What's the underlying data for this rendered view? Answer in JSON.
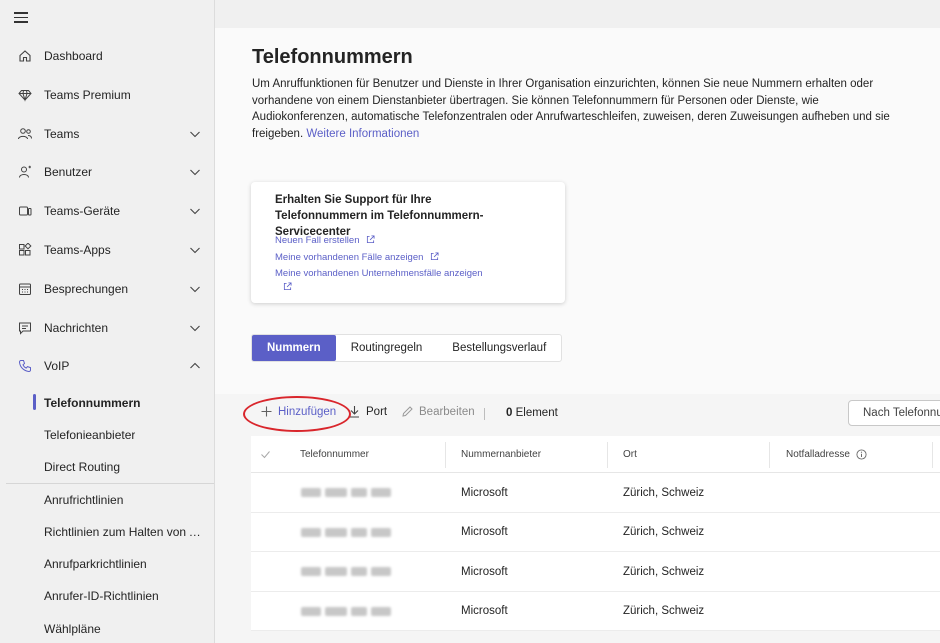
{
  "sidebar": {
    "items": [
      {
        "label": "Dashboard",
        "icon": "home-icon",
        "expandable": false
      },
      {
        "label": "Teams Premium",
        "icon": "diamond-icon",
        "expandable": false
      },
      {
        "label": "Teams",
        "icon": "people-icon",
        "expandable": true
      },
      {
        "label": "Benutzer",
        "icon": "person-icon",
        "expandable": true
      },
      {
        "label": "Teams-Geräte",
        "icon": "devices-icon",
        "expandable": true
      },
      {
        "label": "Teams-Apps",
        "icon": "apps-icon",
        "expandable": true
      },
      {
        "label": "Besprechungen",
        "icon": "calendar-icon",
        "expandable": true
      },
      {
        "label": "Nachrichten",
        "icon": "chat-icon",
        "expandable": true
      },
      {
        "label": "VoIP",
        "icon": "phone-icon",
        "expandable": true,
        "expanded": true
      }
    ],
    "voip_subitems": [
      {
        "label": "Telefonnummern",
        "active": true
      },
      {
        "label": "Telefonieanbieter",
        "active": false
      },
      {
        "label": "Direct Routing",
        "active": false
      },
      {
        "label": "Anrufrichtlinien",
        "active": false
      },
      {
        "label": "Richtlinien zum Halten von A...",
        "active": false
      },
      {
        "label": "Anrufparkrichtlinien",
        "active": false
      },
      {
        "label": "Anrufer-ID-Richtlinien",
        "active": false
      },
      {
        "label": "Wählpläne",
        "active": false
      }
    ]
  },
  "main": {
    "title": "Telefonnummern",
    "description": "Um Anruffunktionen für Benutzer und Dienste in Ihrer Organisation einzurichten, können Sie neue Nummern erhalten oder vorhandene von einem Dienstanbieter übertragen. Sie können Telefonnummern für Personen oder Dienste, wie Audiokonferenzen, automatische Telefonzentralen oder Anrufwarteschleifen, zuweisen, deren Zuweisungen aufheben und sie freigeben.",
    "more_info_link": "Weitere Informationen",
    "support_card": {
      "title": "Erhalten Sie Support für Ihre Telefonnummern im Telefonnummern-Servicecenter",
      "links": [
        "Neuen Fall erstellen",
        "Meine vorhandenen Fälle anzeigen",
        "Meine vorhandenen Unternehmensfälle anzeigen"
      ]
    },
    "tabs": [
      {
        "label": "Nummern",
        "active": true
      },
      {
        "label": "Routingregeln",
        "active": false
      },
      {
        "label": "Bestellungsverlauf",
        "active": false
      }
    ],
    "toolbar": {
      "add_label": "Hinzufügen",
      "port_label": "Port",
      "edit_label": "Bearbeiten",
      "count_number": "0",
      "count_label": "Element",
      "search_placeholder": "Nach Telefonnummer suchen"
    },
    "table": {
      "columns": [
        "Telefonnummer",
        "Nummernanbieter",
        "Ort",
        "Notfalladresse"
      ],
      "rows": [
        {
          "provider": "Microsoft",
          "location": "Zürich, Schweiz"
        },
        {
          "provider": "Microsoft",
          "location": "Zürich, Schweiz"
        },
        {
          "provider": "Microsoft",
          "location": "Zürich, Schweiz"
        },
        {
          "provider": "Microsoft",
          "location": "Zürich, Schweiz"
        }
      ]
    }
  },
  "colors": {
    "accent": "#5b5fc7",
    "highlight_circle": "#d9262c"
  }
}
